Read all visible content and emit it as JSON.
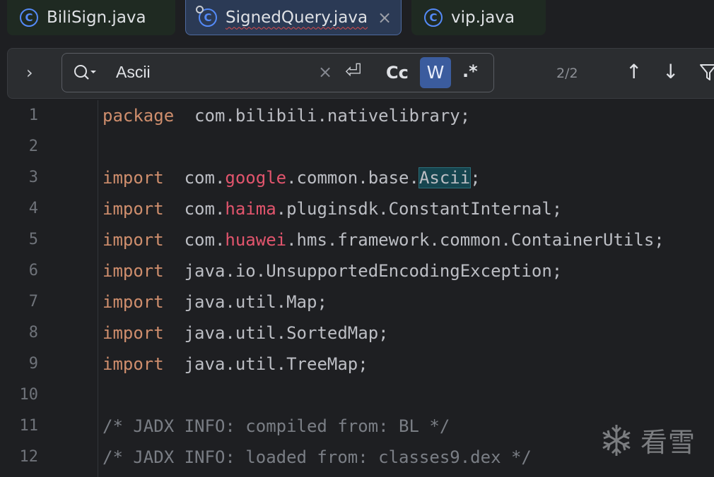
{
  "tabs": [
    {
      "label": "BiliSign.java",
      "active": false
    },
    {
      "label": "SignedQuery.java",
      "active": true,
      "close": "×"
    },
    {
      "label": "vip.java",
      "active": false
    }
  ],
  "search": {
    "expand": "›",
    "query": "Ascii",
    "clear": "×",
    "newline": "⏎",
    "match_case": "Cc",
    "whole_words": "W",
    "regex": ".*",
    "counter": "2/2",
    "prev": "↑",
    "next": "↓"
  },
  "code_lines": [
    {
      "n": "1",
      "parts": [
        [
          "kw",
          "package"
        ],
        [
          "",
          "  com.bilibili.nativelibrary;"
        ]
      ]
    },
    {
      "n": "2",
      "parts": []
    },
    {
      "n": "3",
      "parts": [
        [
          "kw",
          "import"
        ],
        [
          "",
          "  com."
        ],
        [
          "pk",
          "google"
        ],
        [
          "",
          ".common.base."
        ],
        [
          "hl",
          "Ascii"
        ],
        [
          "",
          ";"
        ]
      ]
    },
    {
      "n": "4",
      "parts": [
        [
          "kw",
          "import"
        ],
        [
          "",
          "  com."
        ],
        [
          "pk",
          "haima"
        ],
        [
          "",
          ".pluginsdk.ConstantInternal;"
        ]
      ]
    },
    {
      "n": "5",
      "parts": [
        [
          "kw",
          "import"
        ],
        [
          "",
          "  com."
        ],
        [
          "pk",
          "huawei"
        ],
        [
          "",
          ".hms.framework.common.ContainerUtils;"
        ]
      ]
    },
    {
      "n": "6",
      "parts": [
        [
          "kw",
          "import"
        ],
        [
          "",
          "  java.io.UnsupportedEncodingException;"
        ]
      ]
    },
    {
      "n": "7",
      "parts": [
        [
          "kw",
          "import"
        ],
        [
          "",
          "  java.util.Map;"
        ]
      ]
    },
    {
      "n": "8",
      "parts": [
        [
          "kw",
          "import"
        ],
        [
          "",
          "  java.util.SortedMap;"
        ]
      ]
    },
    {
      "n": "9",
      "parts": [
        [
          "kw",
          "import"
        ],
        [
          "",
          "  java.util.TreeMap;"
        ]
      ]
    },
    {
      "n": "10",
      "parts": []
    },
    {
      "n": "11",
      "parts": [
        [
          "cm",
          "/* JADX INFO: compiled from: BL */"
        ]
      ]
    },
    {
      "n": "12",
      "parts": [
        [
          "cm",
          "/* JADX INFO: loaded from: classes9.dex */"
        ]
      ]
    }
  ],
  "watermark": "看雪",
  "colors": {
    "keyword": "#cf8e6d",
    "package_red": "#e2556d",
    "comment": "#7a7e85",
    "match_highlight": "#16454f",
    "whole_word_active": "#3b5c9e"
  }
}
